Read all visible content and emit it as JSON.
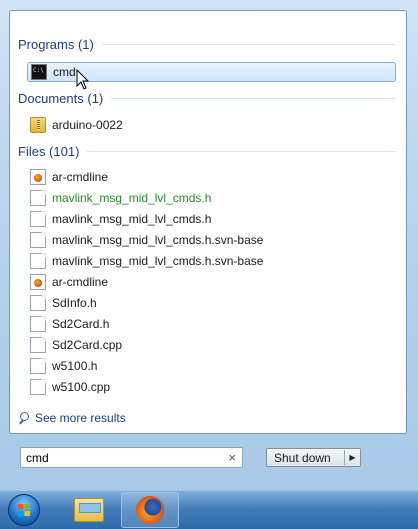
{
  "programs": {
    "header": "Programs (1)",
    "items": [
      {
        "label": "cmd",
        "icon": "cmd-icon"
      }
    ]
  },
  "documents": {
    "header": "Documents (1)",
    "items": [
      {
        "label": "arduino-0022",
        "icon": "zip-folder-icon"
      }
    ]
  },
  "files": {
    "header": "Files (101)",
    "items": [
      {
        "label": "ar-cmdline",
        "icon": "firefox-file-icon"
      },
      {
        "label": "mavlink_msg_mid_lvl_cmds.h",
        "icon": "document-icon"
      },
      {
        "label": "mavlink_msg_mid_lvl_cmds.h",
        "icon": "document-icon"
      },
      {
        "label": "mavlink_msg_mid_lvl_cmds.h.svn-base",
        "icon": "document-icon"
      },
      {
        "label": "mavlink_msg_mid_lvl_cmds.h.svn-base",
        "icon": "document-icon"
      },
      {
        "label": "ar-cmdline",
        "icon": "firefox-file-icon"
      },
      {
        "label": "SdInfo.h",
        "icon": "document-icon"
      },
      {
        "label": "Sd2Card.h",
        "icon": "document-icon"
      },
      {
        "label": "Sd2Card.cpp",
        "icon": "document-icon"
      },
      {
        "label": "w5100.h",
        "icon": "document-icon"
      },
      {
        "label": "w5100.cpp",
        "icon": "document-icon"
      }
    ]
  },
  "see_more": {
    "label": "See more results"
  },
  "search": {
    "value": "cmd",
    "clear_glyph": "×"
  },
  "shutdown": {
    "label": "Shut down",
    "arrow": "▶"
  },
  "taskbar": {
    "items": [
      "start-orb",
      "windows-explorer",
      "firefox"
    ]
  },
  "colors": {
    "accent": "#1e3f7a",
    "highlight_text": "#2a8a2a",
    "selection_border": "#84acdd"
  }
}
